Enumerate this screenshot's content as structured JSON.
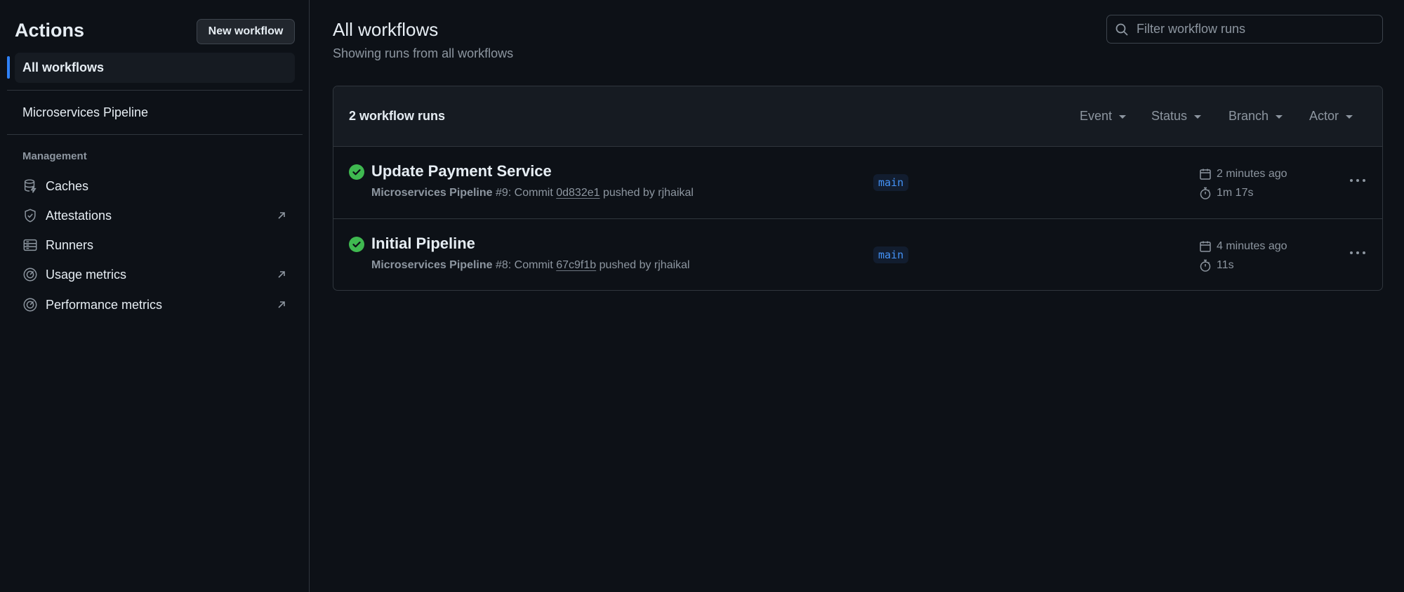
{
  "sidebar": {
    "title": "Actions",
    "new_workflow_label": "New workflow",
    "all_workflows_label": "All workflows",
    "workflows": [
      {
        "label": "Microservices Pipeline"
      }
    ],
    "section_label": "Management",
    "management_items": [
      {
        "label": "Caches",
        "icon": "database-icon",
        "external": false
      },
      {
        "label": "Attestations",
        "icon": "verified-shield-icon",
        "external": true
      },
      {
        "label": "Runners",
        "icon": "server-icon",
        "external": false
      },
      {
        "label": "Usage metrics",
        "icon": "meter-icon",
        "external": true
      },
      {
        "label": "Performance metrics",
        "icon": "meter-icon",
        "external": true
      }
    ]
  },
  "main": {
    "title": "All workflows",
    "subtitle": "Showing runs from all workflows",
    "search": {
      "placeholder": "Filter workflow runs",
      "value": ""
    },
    "runs_count_label": "2 workflow runs",
    "filters": [
      {
        "label": "Event"
      },
      {
        "label": "Status"
      },
      {
        "label": "Branch"
      },
      {
        "label": "Actor"
      }
    ],
    "runs": [
      {
        "title": "Update Payment Service",
        "workflow": "Microservices Pipeline",
        "run_number": "#9",
        "commit_prefix": ": Commit",
        "sha": "0d832e1",
        "pushed_by": "pushed by rjhaikal",
        "branch": "main",
        "when": "2 minutes ago",
        "duration": "1m 17s",
        "status": "success"
      },
      {
        "title": "Initial Pipeline",
        "workflow": "Microservices Pipeline",
        "run_number": "#8",
        "commit_prefix": ": Commit",
        "sha": "67c9f1b",
        "pushed_by": "pushed by rjhaikal",
        "branch": "main",
        "when": "4 minutes ago",
        "duration": "11s",
        "status": "success"
      }
    ]
  },
  "colors": {
    "background": "#0d1117",
    "accent": "#2f81f7",
    "success": "#3fb950",
    "muted_text": "#8d96a0",
    "border": "#30363d"
  }
}
